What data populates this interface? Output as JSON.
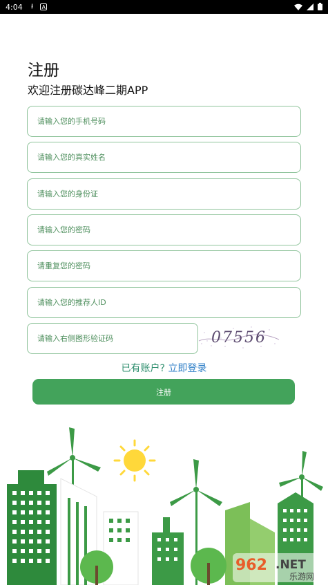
{
  "status_bar": {
    "time": "4:04"
  },
  "header": {
    "title": "注册",
    "subtitle": "欢迎注册碳达峰二期APP"
  },
  "form": {
    "phone_placeholder": "请输入您的手机号码",
    "name_placeholder": "请输入您的真实姓名",
    "id_card_placeholder": "请输入您的身份证",
    "password_placeholder": "请输入您的密码",
    "password_repeat_placeholder": "请重复您的密码",
    "referrer_placeholder": "请输入您的推荐人ID",
    "captcha_placeholder": "请输入右侧图形验证码",
    "captcha_text": "07556"
  },
  "login": {
    "question": "已有账户?",
    "link": "立即登录"
  },
  "register_button": "注册",
  "watermark": {
    "number": "962",
    "net": ".NET",
    "site": "乐游网"
  },
  "colors": {
    "accent_green": "#43a35b",
    "field_border": "#8ec39a",
    "link_blue": "#2f7fc7"
  }
}
